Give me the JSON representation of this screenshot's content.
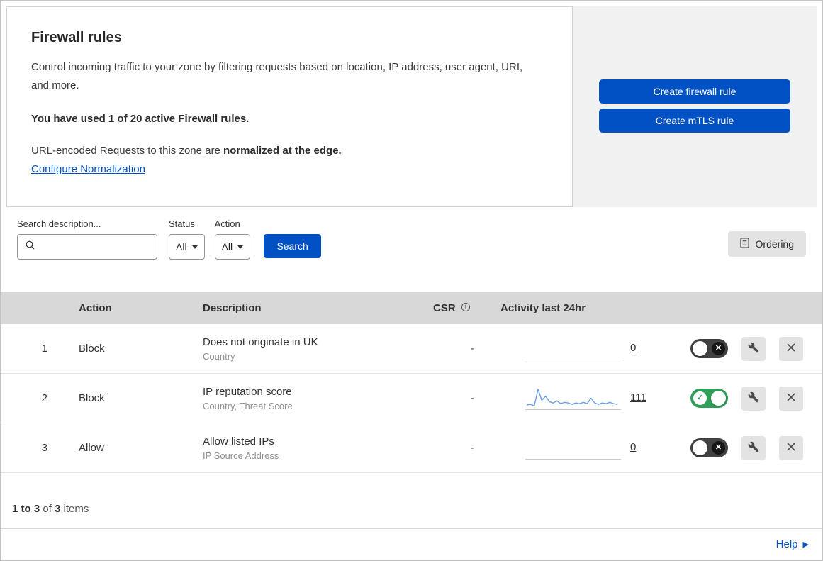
{
  "panel": {
    "title": "Firewall rules",
    "description": "Control incoming traffic to your zone by filtering requests based on location, IP address, user agent, URI, and more.",
    "usage_text": "You have used 1 of 20 active Firewall rules.",
    "normalization": {
      "prefix": "URL-encoded Requests to this zone are ",
      "bold": "normalized at the edge.",
      "link": "Configure Normalization"
    }
  },
  "actions_panel": {
    "create_firewall_rule": "Create firewall rule",
    "create_mtls_rule": "Create mTLS rule"
  },
  "filters": {
    "search_label": "Search description...",
    "status": {
      "label": "Status",
      "value": "All"
    },
    "action": {
      "label": "Action",
      "value": "All"
    },
    "search_button": "Search",
    "ordering_button": "Ordering"
  },
  "table": {
    "headers": {
      "action": "Action",
      "description": "Description",
      "csr": "CSR",
      "activity": "Activity last 24hr"
    },
    "rows": [
      {
        "index": "1",
        "action": "Block",
        "description": "Does not originate in UK",
        "description_sub": "Country",
        "csr": "-",
        "activity_count": "0",
        "enabled": false,
        "sparkline": []
      },
      {
        "index": "2",
        "action": "Block",
        "description": "IP reputation score",
        "description_sub": "Country, Threat Score",
        "csr": "-",
        "activity_count": "111",
        "enabled": true,
        "sparkline": [
          3,
          4,
          2,
          26,
          10,
          16,
          8,
          6,
          9,
          5,
          7,
          6,
          4,
          6,
          5,
          7,
          5,
          13,
          6,
          4,
          6,
          5,
          7,
          5,
          4
        ]
      },
      {
        "index": "3",
        "action": "Allow",
        "description": "Allow listed IPs",
        "description_sub": "IP Source Address",
        "csr": "-",
        "activity_count": "0",
        "enabled": false,
        "sparkline": []
      }
    ]
  },
  "footer": {
    "range": "1 to 3",
    "of": " of ",
    "total": "3",
    "items": " items"
  },
  "help_link": "Help",
  "colors": {
    "primary_blue": "#0051c3",
    "toggle_on_green": "#2f9e59",
    "sparkline_blue": "#6a9fe6"
  }
}
